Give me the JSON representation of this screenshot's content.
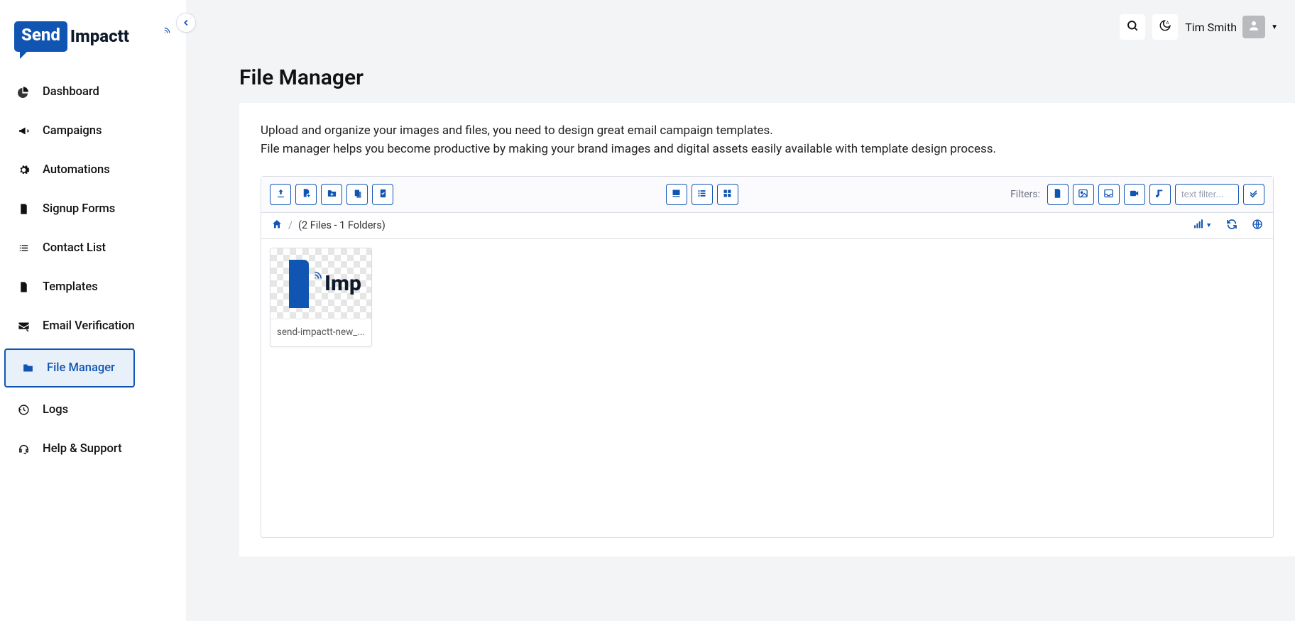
{
  "brand": {
    "part1": "Send",
    "part2": "Impactt"
  },
  "sidebar": {
    "items": [
      {
        "label": "Dashboard",
        "icon": "pie"
      },
      {
        "label": "Campaigns",
        "icon": "bullhorn"
      },
      {
        "label": "Automations",
        "icon": "gears"
      },
      {
        "label": "Signup Forms",
        "icon": "form"
      },
      {
        "label": "Contact List",
        "icon": "list"
      },
      {
        "label": "Templates",
        "icon": "doc"
      },
      {
        "label": "Email Verification",
        "icon": "mailcheck"
      },
      {
        "label": "File Manager",
        "icon": "folder",
        "active": true
      },
      {
        "label": "Logs",
        "icon": "history"
      },
      {
        "label": "Help & Support",
        "icon": "headset"
      }
    ]
  },
  "topbar": {
    "user_name": "Tim Smith"
  },
  "page": {
    "title": "File Manager",
    "intro_line1": "Upload and organize your images and files, you need to design great email campaign templates.",
    "intro_line2": "File manager helps you become productive by making your brand images and digital assets easily available with template design process."
  },
  "fm": {
    "filters_label": "Filters:",
    "text_filter_placeholder": "text filter...",
    "crumb_stats": "(2 Files - 1 Folders)",
    "files": [
      {
        "name": "send-impactt-new_..."
      }
    ]
  }
}
